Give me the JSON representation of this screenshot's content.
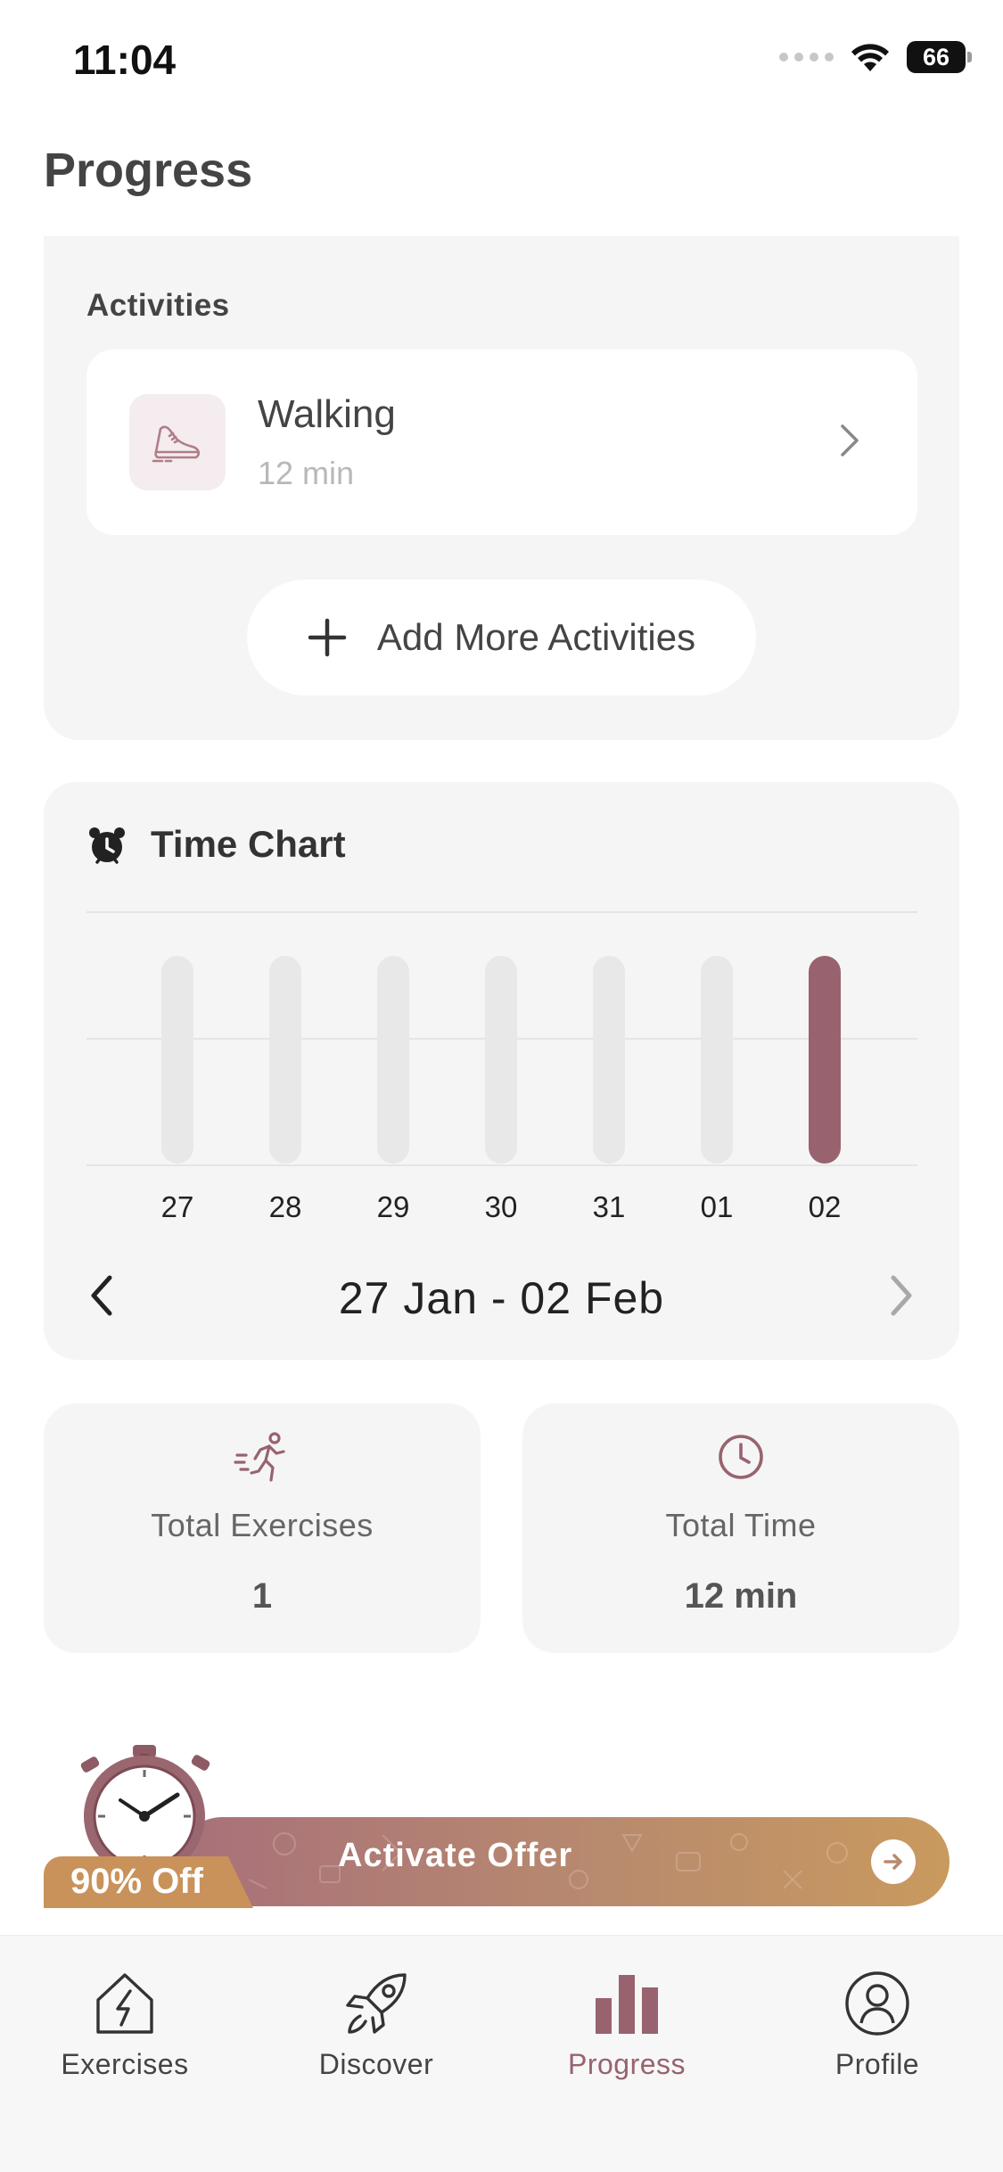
{
  "status_bar": {
    "time": "11:04",
    "battery": "66"
  },
  "page_title": "Progress",
  "activities": {
    "heading": "Activities",
    "items": [
      {
        "name": "Walking",
        "duration": "12 min",
        "icon": "sneaker-icon"
      }
    ],
    "add_button_label": "Add More Activities"
  },
  "time_chart": {
    "title": "Time Chart",
    "date_range": "27 Jan - 02 Feb"
  },
  "chart_data": {
    "type": "bar",
    "categories": [
      "27",
      "28",
      "29",
      "30",
      "31",
      "01",
      "02"
    ],
    "values": [
      0,
      0,
      0,
      0,
      0,
      0,
      12
    ],
    "title": "Time Chart",
    "xlabel": "",
    "ylabel": "",
    "grid": true,
    "highlight_color": "#98636e",
    "track_color": "#e8e8e8"
  },
  "stats": {
    "total_exercises": {
      "label": "Total Exercises",
      "value": "1"
    },
    "total_time": {
      "label": "Total Time",
      "value": "12 min"
    }
  },
  "offer": {
    "label": "Activate Offer",
    "badge": "90% Off"
  },
  "tabs": [
    {
      "label": "Exercises",
      "icon": "lightning-house-icon",
      "active": false
    },
    {
      "label": "Discover",
      "icon": "rocket-icon",
      "active": false
    },
    {
      "label": "Progress",
      "icon": "bar-chart-icon",
      "active": true
    },
    {
      "label": "Profile",
      "icon": "user-circle-icon",
      "active": false
    }
  ],
  "colors": {
    "accent": "#98636e",
    "card_bg": "#f5f5f5",
    "offer_gold": "#c9925a"
  }
}
